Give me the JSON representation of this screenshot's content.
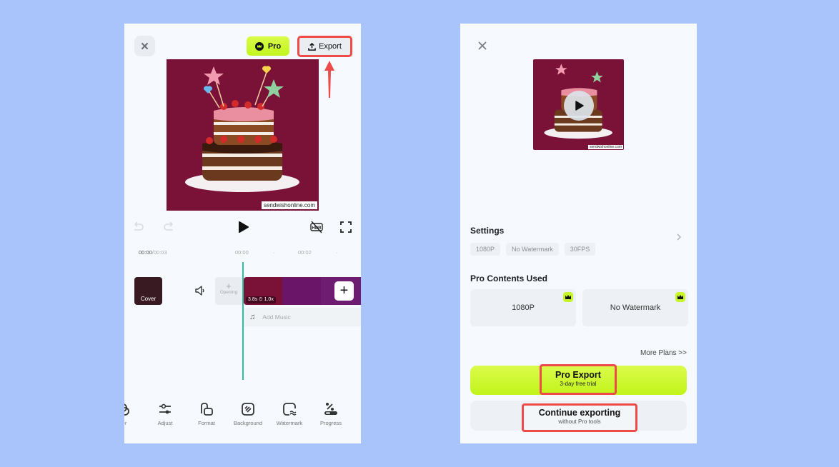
{
  "editor": {
    "close_icon": "close-icon",
    "pro_label": "Pro",
    "export_label": "Export",
    "preview_watermark": "sendwishonline.com",
    "controls": [
      "undo-icon",
      "redo-icon",
      "play-icon",
      "hdr-off-icon",
      "fullscreen-icon"
    ],
    "timeline": {
      "current_time": "00:00",
      "total_time": "/00:03",
      "ticks": [
        "00:00",
        "·",
        "00:02",
        "·"
      ],
      "cover_label": "Cover",
      "opening_plus": "+",
      "opening_label": "Opening",
      "clip_duration": "3.8s",
      "clip_speed": "1.0x",
      "add_music_label": "Add Music"
    },
    "toolbar": [
      {
        "label": "er",
        "icon": "filter-icon"
      },
      {
        "label": "Adjust",
        "icon": "sliders-icon"
      },
      {
        "label": "Format",
        "icon": "format-icon"
      },
      {
        "label": "Background",
        "icon": "background-icon"
      },
      {
        "label": "Watermark",
        "icon": "watermark-icon"
      },
      {
        "label": "Progress",
        "icon": "progress-icon"
      }
    ]
  },
  "export_panel": {
    "thumb_watermark": "sendwishonline.com",
    "settings_title": "Settings",
    "settings_chips": [
      "1080P",
      "No Watermark",
      "30FPS"
    ],
    "pro_contents_title": "Pro Contents Used",
    "pro_contents": [
      "1080P",
      "No Watermark"
    ],
    "more_plans": "More Plans >>",
    "pro_export_title": "Pro Export",
    "pro_export_sub": "3-day free trial",
    "continue_title": "Continue exporting",
    "continue_sub": "without Pro tools"
  },
  "colors": {
    "background": "#a9c4fb",
    "accent_lime": "#c7f52a",
    "highlight_red": "#ee4a4a",
    "playhead": "#28c3a6",
    "preview_bg": "#7a1238"
  }
}
